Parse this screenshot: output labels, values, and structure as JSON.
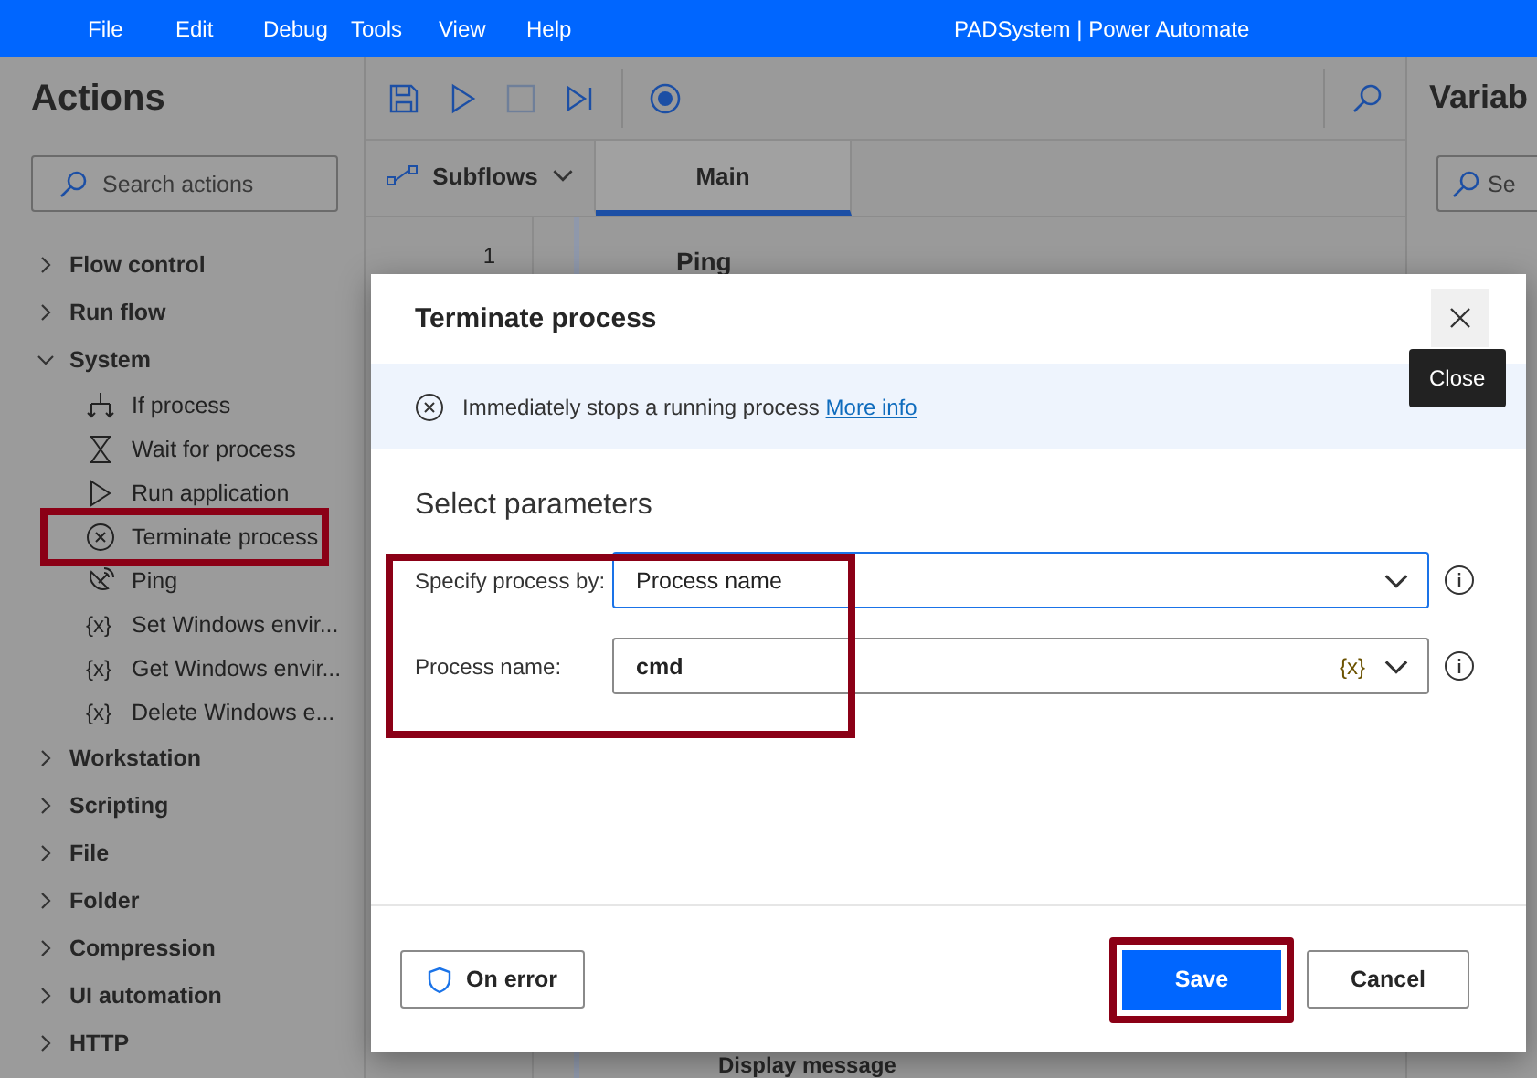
{
  "menu_bar": {
    "items": [
      "File",
      "Edit",
      "Debug",
      "Tools",
      "View",
      "Help"
    ],
    "title": "PADSystem | Power Automate"
  },
  "actions_panel": {
    "title": "Actions",
    "search": {
      "placeholder": "Search actions"
    },
    "tree": [
      {
        "label": "Flow control",
        "expanded": false
      },
      {
        "label": "Run flow",
        "expanded": false
      },
      {
        "label": "System",
        "expanded": true,
        "children": [
          {
            "label": "If process",
            "kind": "branch",
            "highlighted": false
          },
          {
            "label": "Wait for process",
            "kind": "hourglass",
            "highlighted": false
          },
          {
            "label": "Run application",
            "kind": "play",
            "highlighted": false
          },
          {
            "label": "Terminate process",
            "kind": "terminate",
            "highlighted": true
          },
          {
            "label": "Ping",
            "kind": "ping",
            "highlighted": false
          },
          {
            "label": "Set Windows envir...",
            "kind": "variable",
            "glyph": "{x}",
            "highlighted": false
          },
          {
            "label": "Get Windows envir...",
            "kind": "variable",
            "glyph": "{x}",
            "highlighted": false
          },
          {
            "label": "Delete Windows e...",
            "kind": "variable",
            "glyph": "{x}",
            "highlighted": false
          }
        ]
      },
      {
        "label": "Workstation",
        "expanded": false
      },
      {
        "label": "Scripting",
        "expanded": false
      },
      {
        "label": "File",
        "expanded": false
      },
      {
        "label": "Folder",
        "expanded": false
      },
      {
        "label": "Compression",
        "expanded": false
      },
      {
        "label": "UI automation",
        "expanded": false
      },
      {
        "label": "HTTP",
        "expanded": false
      }
    ]
  },
  "designer": {
    "tabs": [
      {
        "label": "Subflows",
        "kind": "dropdown",
        "selected": false
      },
      {
        "label": "Main",
        "kind": "tab",
        "selected": true
      }
    ],
    "line_number": "1",
    "actions": [
      "Ping",
      "Display message"
    ]
  },
  "variables_panel": {
    "title": "Variab",
    "search": {
      "placeholder": "Se"
    }
  },
  "dialog": {
    "title": "Terminate process",
    "close_tooltip": "Close",
    "description": "Immediately stops a running process",
    "link": "More info",
    "section": "Select parameters",
    "parameters_highlighted": true,
    "fields": [
      {
        "label": "Specify process by:",
        "value": "Process name",
        "kind": "dropdown",
        "focused": true
      },
      {
        "label": "Process name:",
        "value": "cmd",
        "kind": "text",
        "variable_button": "{x}",
        "focused": false
      }
    ],
    "buttons": [
      {
        "label": "On error",
        "kind": "shield",
        "highlighted": false
      },
      {
        "label": "Save",
        "kind": "primary",
        "highlighted": true
      },
      {
        "label": "Cancel",
        "kind": "secondary",
        "highlighted": false
      }
    ]
  }
}
